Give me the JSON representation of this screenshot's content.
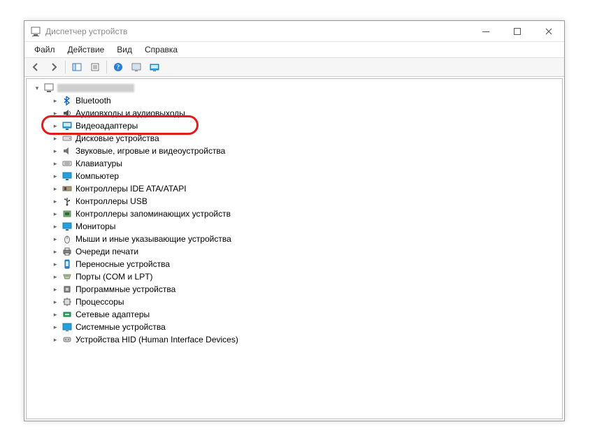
{
  "window": {
    "title": "Диспетчер устройств"
  },
  "menu": {
    "file": "Файл",
    "action": "Действие",
    "view": "Вид",
    "help": "Справка"
  },
  "tree": {
    "root": "DESKTOP",
    "items": [
      {
        "label": "Bluetooth"
      },
      {
        "label": "Аудиовходы и аудиовыходы"
      },
      {
        "label": "Видеоадаптеры"
      },
      {
        "label": "Дисковые устройства"
      },
      {
        "label": "Звуковые, игровые и видеоустройства"
      },
      {
        "label": "Клавиатуры"
      },
      {
        "label": "Компьютер"
      },
      {
        "label": "Контроллеры IDE ATA/ATAPI"
      },
      {
        "label": "Контроллеры USB"
      },
      {
        "label": "Контроллеры запоминающих устройств"
      },
      {
        "label": "Мониторы"
      },
      {
        "label": "Мыши и иные указывающие устройства"
      },
      {
        "label": "Очереди печати"
      },
      {
        "label": "Переносные устройства"
      },
      {
        "label": "Порты (COM и LPT)"
      },
      {
        "label": "Программные устройства"
      },
      {
        "label": "Процессоры"
      },
      {
        "label": "Сетевые адаптеры"
      },
      {
        "label": "Системные устройства"
      },
      {
        "label": "Устройства HID (Human Interface Devices)"
      }
    ]
  },
  "icons": {
    "bluetooth": "#0a63c4",
    "monitor": "#25a0da",
    "disk": "#8a8a8a",
    "usb": "#444",
    "net": "#2aa35a"
  }
}
